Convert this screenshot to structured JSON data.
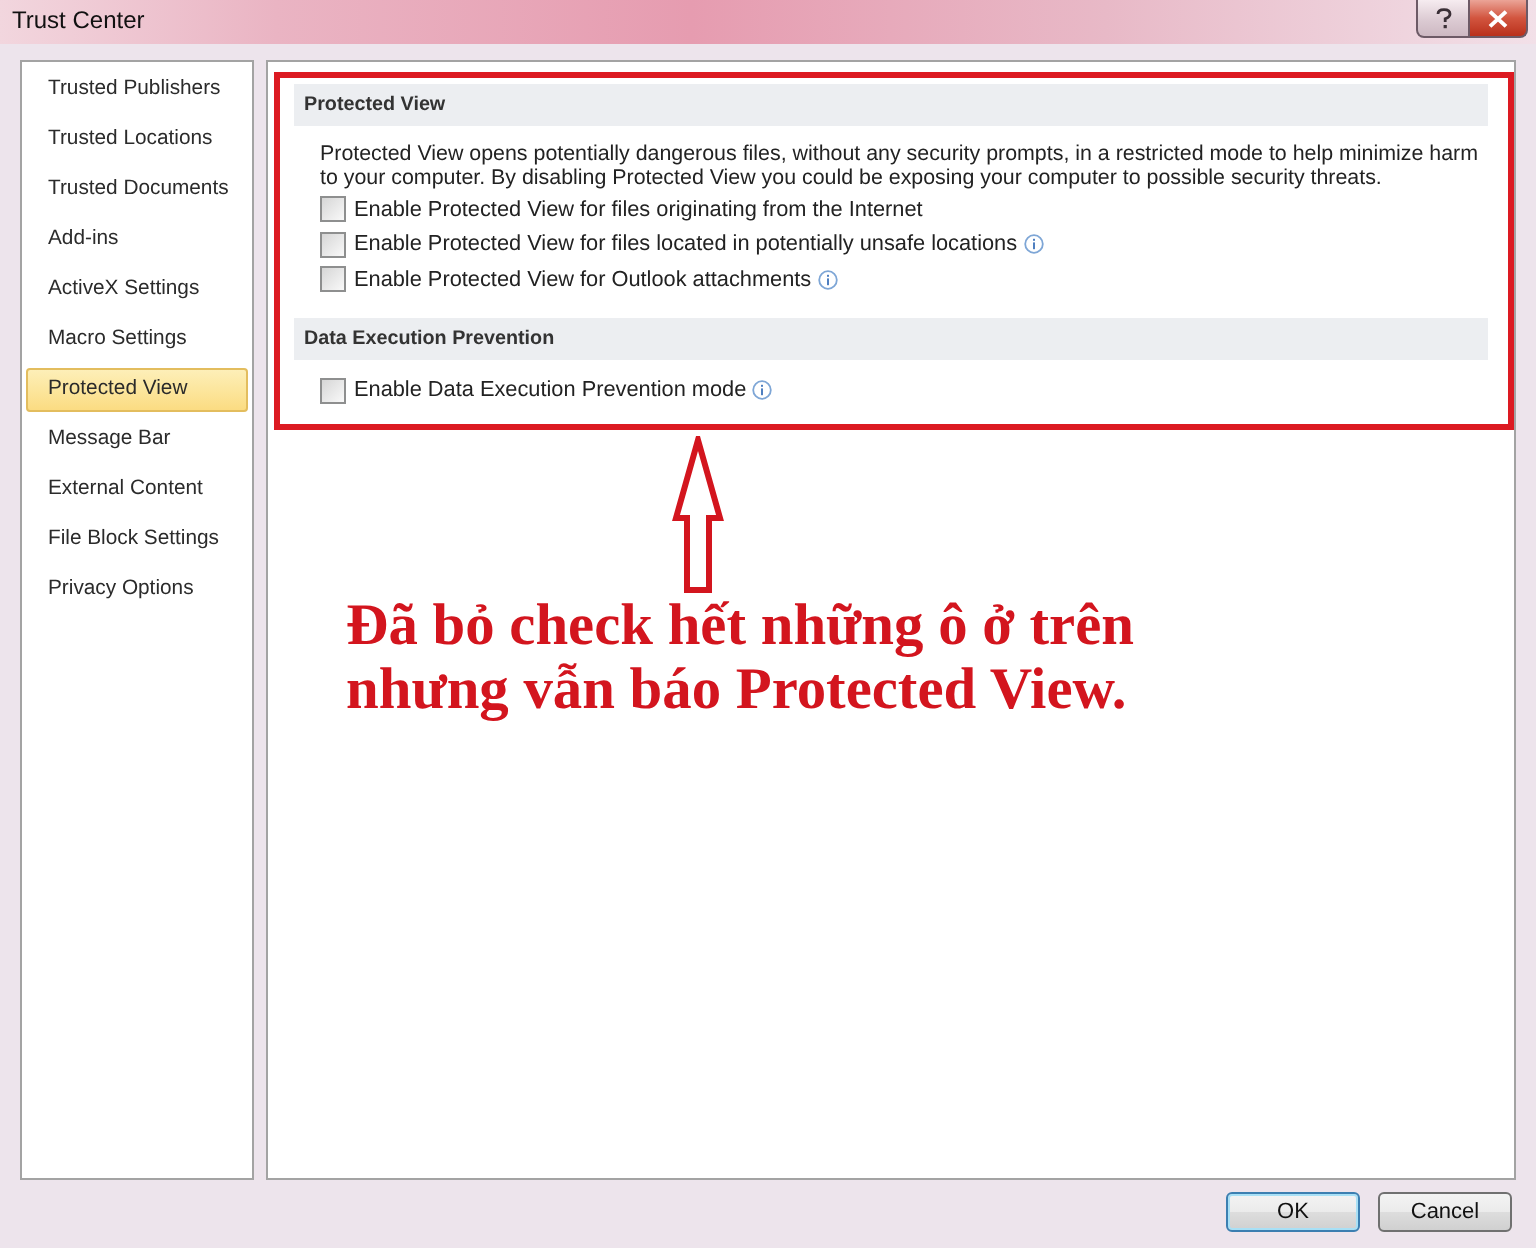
{
  "window": {
    "title": "Trust Center"
  },
  "sidebar": {
    "items": [
      {
        "label": "Trusted Publishers",
        "selected": false
      },
      {
        "label": "Trusted Locations",
        "selected": false
      },
      {
        "label": "Trusted Documents",
        "selected": false
      },
      {
        "label": "Add-ins",
        "selected": false
      },
      {
        "label": "ActiveX Settings",
        "selected": false
      },
      {
        "label": "Macro Settings",
        "selected": false
      },
      {
        "label": "Protected View",
        "selected": true
      },
      {
        "label": "Message Bar",
        "selected": false
      },
      {
        "label": "External Content",
        "selected": false
      },
      {
        "label": "File Block Settings",
        "selected": false
      },
      {
        "label": "Privacy Options",
        "selected": false
      }
    ]
  },
  "sections": [
    {
      "title": "Protected View",
      "description": "Protected View opens potentially dangerous files, without any security prompts, in a restricted mode to help minimize harm to your computer. By disabling Protected View you could be exposing your computer to possible security threats.",
      "options": [
        {
          "label": "Enable Protected View for files originating from the Internet",
          "checked": false,
          "info": false
        },
        {
          "label": "Enable Protected View for files located in potentially unsafe locations",
          "checked": false,
          "info": true
        },
        {
          "label": "Enable Protected View for Outlook attachments",
          "checked": false,
          "info": true
        }
      ]
    },
    {
      "title": "Data Execution Prevention",
      "options": [
        {
          "label": "Enable Data Execution Prevention mode",
          "checked": false,
          "info": true
        }
      ]
    }
  ],
  "annotation": {
    "lines": [
      "Đã bỏ check hết những ô ở trên",
      "nhưng vẫn báo Protected View."
    ]
  },
  "buttons": [
    {
      "label": "OK",
      "default": true
    },
    {
      "label": "Cancel",
      "default": false
    }
  ]
}
